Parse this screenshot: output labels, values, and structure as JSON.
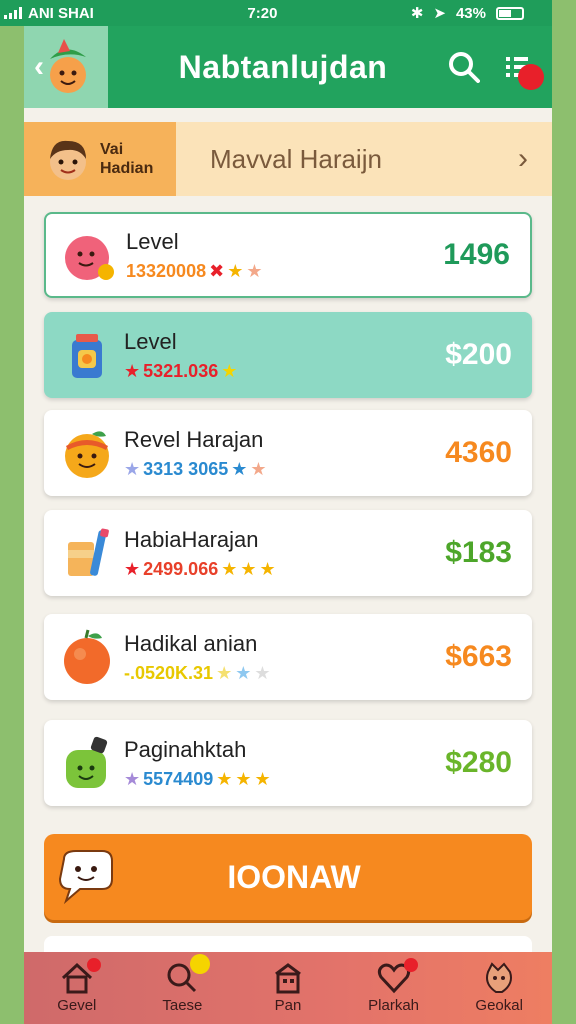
{
  "status_bar": {
    "carrier": "ANI SHAI",
    "time": "7:20",
    "battery": "43%"
  },
  "app_bar": {
    "title": "Nabtanlujdan"
  },
  "banner": {
    "user_label_1": "Vai",
    "user_label_2": "Hadian",
    "title": "Mavval Haraijn"
  },
  "items": [
    {
      "title": "Level",
      "code": "13320008",
      "value": "1496",
      "value_color": "#1f9a5a",
      "icon": "pink-blob-icon",
      "stars": [
        {
          "c": "#e8202a"
        },
        {
          "c": "#f5b400"
        },
        {
          "c": "#f3a88a"
        }
      ]
    },
    {
      "title": "Level",
      "code": "5321.036",
      "value": "$200",
      "value_color": "#ffffff",
      "icon": "jar-icon",
      "stars": [
        {
          "c": "#e8202a"
        },
        {
          "c": "#f5d400"
        }
      ]
    },
    {
      "title": "Revel Harajan",
      "code": "3313 3065",
      "value": "4360",
      "value_color": "#f6891f",
      "icon": "orange-fruit-icon",
      "stars": [
        {
          "c": "#9aa6e8"
        },
        {
          "c": "#f3a88a"
        }
      ]
    },
    {
      "title": "HabiaHarajan",
      "code": "2499.066",
      "value": "$183",
      "value_color": "#4da62a",
      "icon": "cup-icon",
      "stars": [
        {
          "c": "#e8202a"
        },
        {
          "c": "#f5b400"
        },
        {
          "c": "#f5b400"
        },
        {
          "c": "#f5b400"
        }
      ]
    },
    {
      "title": "Hadikal anian",
      "code": "-.0520K.31",
      "value": "$663",
      "value_color": "#f6891f",
      "icon": "tangerine-icon",
      "stars": [
        {
          "c": "#f5e070"
        },
        {
          "c": "#8ec8f0"
        },
        {
          "c": "#dddddd"
        }
      ]
    },
    {
      "title": "Paginahktah",
      "code": "5574409",
      "value": "$280",
      "value_color": "#6ab52a",
      "icon": "green-bottle-icon",
      "stars": [
        {
          "c": "#a58ad8"
        },
        {
          "c": "#f5b400"
        },
        {
          "c": "#f5b400"
        },
        {
          "c": "#f5b400"
        }
      ]
    }
  ],
  "cta": {
    "label": "IOONAW"
  },
  "bottom_nav": [
    {
      "label": "Gevel",
      "icon": "home-icon"
    },
    {
      "label": "Taese",
      "icon": "search-icon"
    },
    {
      "label": "Pan",
      "icon": "building-icon"
    },
    {
      "label": "Plarkah",
      "icon": "heart-icon"
    },
    {
      "label": "Geokal",
      "icon": "mascot-icon"
    }
  ],
  "colors": {
    "primary": "#22a35e",
    "accent": "#f6891f",
    "banner": "#fbe3b9"
  }
}
